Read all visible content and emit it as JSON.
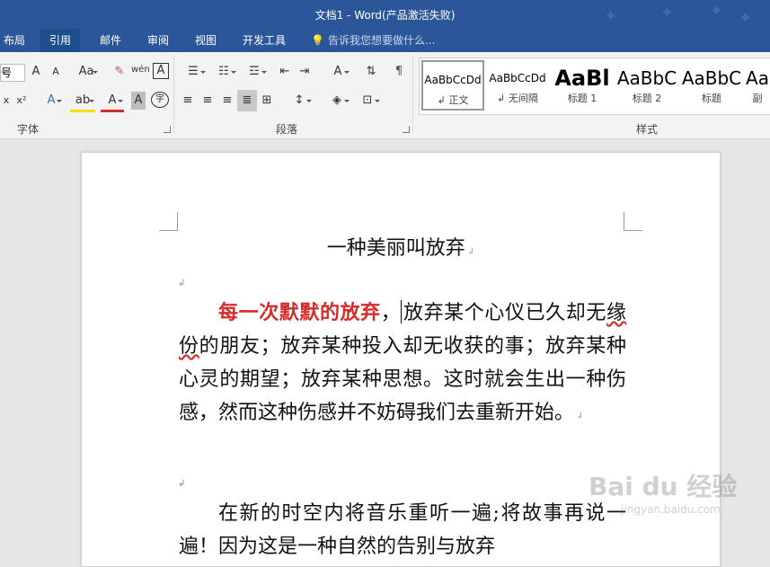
{
  "window": {
    "title": "文档1 - Word(产品激活失败)"
  },
  "tabs": [
    {
      "label": "布局"
    },
    {
      "label": "引用"
    },
    {
      "label": "邮件"
    },
    {
      "label": "审阅"
    },
    {
      "label": "视图"
    },
    {
      "label": "开发工具"
    }
  ],
  "tellme": {
    "text": "告诉我您想要做什么..."
  },
  "ribbon": {
    "font_group": "字体",
    "paragraph_group": "段落",
    "styles_group": "样式",
    "font_size_value": "号",
    "grow_font": "A",
    "shrink_font": "A",
    "change_case": "Aa",
    "phonetic_guide": "wén",
    "char_border": "A",
    "subscript": "x",
    "superscript": "x²",
    "text_effects": "A",
    "highlight": "ab",
    "font_color": "A",
    "char_shading": "A",
    "enclose_char": "字",
    "asian_layout": "A"
  },
  "styles": [
    {
      "sample": "AaBbCcDd",
      "name": "正文"
    },
    {
      "sample": "AaBbCcDd",
      "name": "无间隔"
    },
    {
      "sample": "AaBl",
      "name": "标题 1"
    },
    {
      "sample": "AaBbC",
      "name": "标题 2"
    },
    {
      "sample": "AaBbC",
      "name": "标题"
    },
    {
      "sample": "Aa",
      "name": "副"
    }
  ],
  "document": {
    "title": "一种美丽叫放弃",
    "para1_emph": "每一次默默的放弃",
    "para1_a": "，",
    "para1_b": "放弃某个心仪已久却无",
    "para1_squiggle": "缘份",
    "para1_c": "的朋友；放弃某种投入却无收获的事；放弃某种心灵的期望；放弃某种思想。这时就会生出一种伤感，然而这种伤感并不妨碍我们去重新开始。",
    "para2": "在新的时空内将音乐重听一遍;将故事再说一遍！因为这是一种自然的告别与放弃"
  },
  "watermark": {
    "brand": "Bai du 经验",
    "url": "jingyan.baidu.com"
  },
  "colors": {
    "ribbon_blue": "#2b579a",
    "emphasis_red": "#d62b2b"
  }
}
